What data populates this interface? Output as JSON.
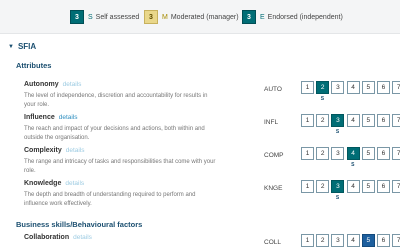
{
  "legend": {
    "self": {
      "box": "3",
      "letter": "S",
      "label": "Self assessed"
    },
    "moderated": {
      "box": "3",
      "letter": "M",
      "label": "Moderated (manager)"
    },
    "endorsed": {
      "box": "3",
      "letter": "E",
      "label": "Endorsed (independent)"
    }
  },
  "section": {
    "title": "SFIA"
  },
  "groups": {
    "attributes": "Attributes",
    "business": "Business skills/Behavioural factors"
  },
  "levels": [
    "1",
    "2",
    "3",
    "4",
    "5",
    "6",
    "7"
  ],
  "details_label": "details",
  "self_mark": "S",
  "skills": [
    {
      "name": "Autonomy",
      "desc": "The level of independence, discretion and accountability for results in your role.",
      "code": "AUTO",
      "selected": 2
    },
    {
      "name": "Influence",
      "desc": "The reach and impact of your decisions and actions, both within and outside the organisation.",
      "code": "INFL",
      "selected": 3
    },
    {
      "name": "Complexity",
      "desc": "The range and intricacy of tasks and responsibilities that come with your role.",
      "code": "COMP",
      "selected": 4
    },
    {
      "name": "Knowledge",
      "desc": "The depth and breadth of understanding required to perform and influence work effectively.",
      "code": "KNGE",
      "selected": 3
    },
    {
      "name": "Collaboration",
      "desc": "",
      "code": "COLL",
      "selected": 5
    }
  ],
  "colors": {
    "accent": "#006d75",
    "moderated": "#e9d78a",
    "link": "#2f8fc0",
    "heading": "#1b4f70"
  }
}
